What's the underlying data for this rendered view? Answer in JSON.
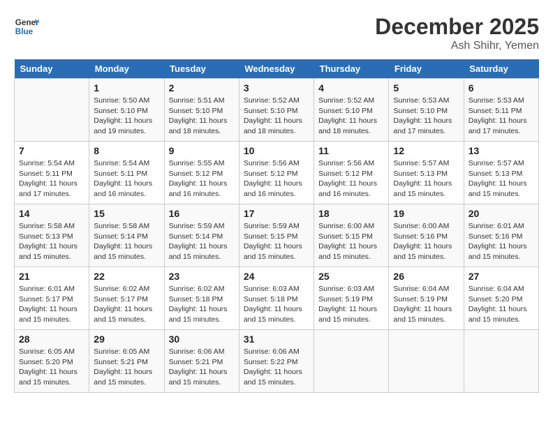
{
  "header": {
    "logo_line1": "General",
    "logo_line2": "Blue",
    "month": "December 2025",
    "location": "Ash Shihr, Yemen"
  },
  "weekdays": [
    "Sunday",
    "Monday",
    "Tuesday",
    "Wednesday",
    "Thursday",
    "Friday",
    "Saturday"
  ],
  "weeks": [
    [
      {
        "day": "",
        "info": ""
      },
      {
        "day": "1",
        "info": "Sunrise: 5:50 AM\nSunset: 5:10 PM\nDaylight: 11 hours and 19 minutes."
      },
      {
        "day": "2",
        "info": "Sunrise: 5:51 AM\nSunset: 5:10 PM\nDaylight: 11 hours and 18 minutes."
      },
      {
        "day": "3",
        "info": "Sunrise: 5:52 AM\nSunset: 5:10 PM\nDaylight: 11 hours and 18 minutes."
      },
      {
        "day": "4",
        "info": "Sunrise: 5:52 AM\nSunset: 5:10 PM\nDaylight: 11 hours and 18 minutes."
      },
      {
        "day": "5",
        "info": "Sunrise: 5:53 AM\nSunset: 5:10 PM\nDaylight: 11 hours and 17 minutes."
      },
      {
        "day": "6",
        "info": "Sunrise: 5:53 AM\nSunset: 5:11 PM\nDaylight: 11 hours and 17 minutes."
      }
    ],
    [
      {
        "day": "7",
        "info": "Sunrise: 5:54 AM\nSunset: 5:11 PM\nDaylight: 11 hours and 17 minutes."
      },
      {
        "day": "8",
        "info": "Sunrise: 5:54 AM\nSunset: 5:11 PM\nDaylight: 11 hours and 16 minutes."
      },
      {
        "day": "9",
        "info": "Sunrise: 5:55 AM\nSunset: 5:12 PM\nDaylight: 11 hours and 16 minutes."
      },
      {
        "day": "10",
        "info": "Sunrise: 5:56 AM\nSunset: 5:12 PM\nDaylight: 11 hours and 16 minutes."
      },
      {
        "day": "11",
        "info": "Sunrise: 5:56 AM\nSunset: 5:12 PM\nDaylight: 11 hours and 16 minutes."
      },
      {
        "day": "12",
        "info": "Sunrise: 5:57 AM\nSunset: 5:13 PM\nDaylight: 11 hours and 15 minutes."
      },
      {
        "day": "13",
        "info": "Sunrise: 5:57 AM\nSunset: 5:13 PM\nDaylight: 11 hours and 15 minutes."
      }
    ],
    [
      {
        "day": "14",
        "info": "Sunrise: 5:58 AM\nSunset: 5:13 PM\nDaylight: 11 hours and 15 minutes."
      },
      {
        "day": "15",
        "info": "Sunrise: 5:58 AM\nSunset: 5:14 PM\nDaylight: 11 hours and 15 minutes."
      },
      {
        "day": "16",
        "info": "Sunrise: 5:59 AM\nSunset: 5:14 PM\nDaylight: 11 hours and 15 minutes."
      },
      {
        "day": "17",
        "info": "Sunrise: 5:59 AM\nSunset: 5:15 PM\nDaylight: 11 hours and 15 minutes."
      },
      {
        "day": "18",
        "info": "Sunrise: 6:00 AM\nSunset: 5:15 PM\nDaylight: 11 hours and 15 minutes."
      },
      {
        "day": "19",
        "info": "Sunrise: 6:00 AM\nSunset: 5:16 PM\nDaylight: 11 hours and 15 minutes."
      },
      {
        "day": "20",
        "info": "Sunrise: 6:01 AM\nSunset: 5:16 PM\nDaylight: 11 hours and 15 minutes."
      }
    ],
    [
      {
        "day": "21",
        "info": "Sunrise: 6:01 AM\nSunset: 5:17 PM\nDaylight: 11 hours and 15 minutes."
      },
      {
        "day": "22",
        "info": "Sunrise: 6:02 AM\nSunset: 5:17 PM\nDaylight: 11 hours and 15 minutes."
      },
      {
        "day": "23",
        "info": "Sunrise: 6:02 AM\nSunset: 5:18 PM\nDaylight: 11 hours and 15 minutes."
      },
      {
        "day": "24",
        "info": "Sunrise: 6:03 AM\nSunset: 5:18 PM\nDaylight: 11 hours and 15 minutes."
      },
      {
        "day": "25",
        "info": "Sunrise: 6:03 AM\nSunset: 5:19 PM\nDaylight: 11 hours and 15 minutes."
      },
      {
        "day": "26",
        "info": "Sunrise: 6:04 AM\nSunset: 5:19 PM\nDaylight: 11 hours and 15 minutes."
      },
      {
        "day": "27",
        "info": "Sunrise: 6:04 AM\nSunset: 5:20 PM\nDaylight: 11 hours and 15 minutes."
      }
    ],
    [
      {
        "day": "28",
        "info": "Sunrise: 6:05 AM\nSunset: 5:20 PM\nDaylight: 11 hours and 15 minutes."
      },
      {
        "day": "29",
        "info": "Sunrise: 6:05 AM\nSunset: 5:21 PM\nDaylight: 11 hours and 15 minutes."
      },
      {
        "day": "30",
        "info": "Sunrise: 6:06 AM\nSunset: 5:21 PM\nDaylight: 11 hours and 15 minutes."
      },
      {
        "day": "31",
        "info": "Sunrise: 6:06 AM\nSunset: 5:22 PM\nDaylight: 11 hours and 15 minutes."
      },
      {
        "day": "",
        "info": ""
      },
      {
        "day": "",
        "info": ""
      },
      {
        "day": "",
        "info": ""
      }
    ]
  ]
}
